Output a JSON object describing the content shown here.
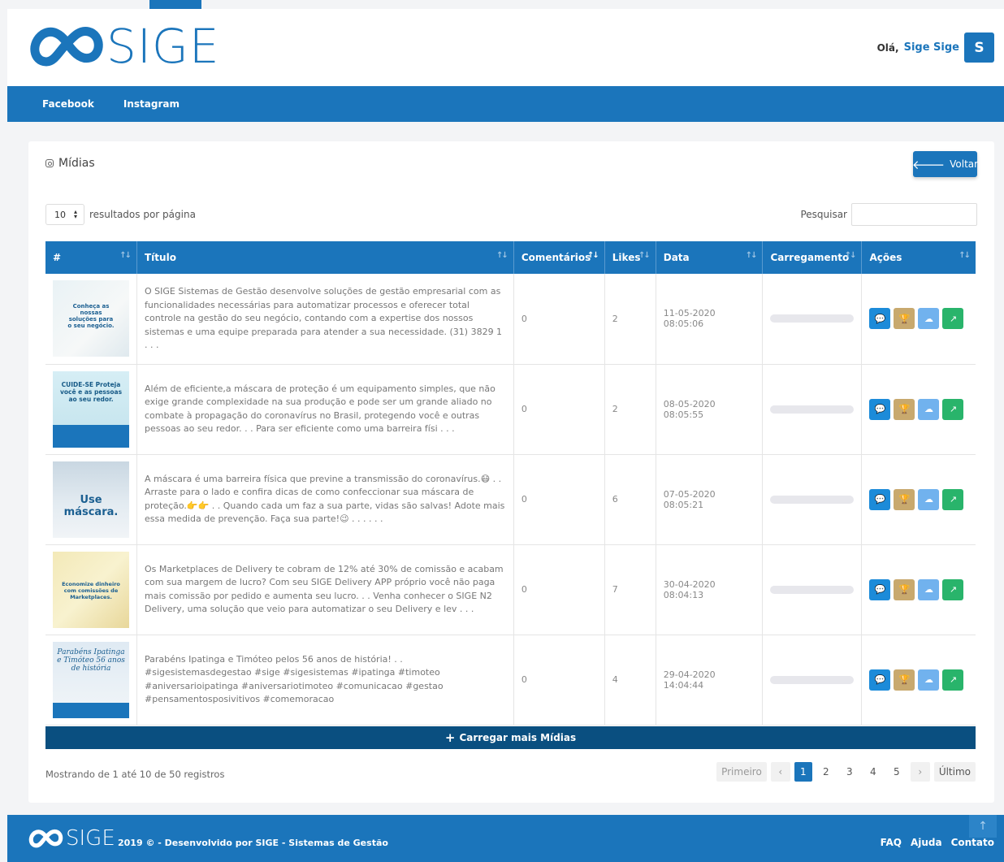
{
  "brand": {
    "name": "SIGE",
    "color": "#1b75bb"
  },
  "header": {
    "greeting": "Olá,",
    "user_name": "Sige Sige",
    "avatar_initial": "S"
  },
  "nav": {
    "items": [
      {
        "label": "Facebook"
      },
      {
        "label": "Instagram"
      }
    ]
  },
  "card": {
    "title": "Mídias",
    "back_label": "Voltar"
  },
  "controls": {
    "page_length": "10",
    "page_length_suffix": "resultados por página",
    "search_label": "Pesquisar",
    "search_value": ""
  },
  "table": {
    "columns": [
      {
        "label": "#"
      },
      {
        "label": "Título"
      },
      {
        "label": "Comentários"
      },
      {
        "label": "Likes"
      },
      {
        "label": "Data"
      },
      {
        "label": "Carregamento"
      },
      {
        "label": "Ações"
      }
    ],
    "rows": [
      {
        "thumb_text": "Conheça as nossas soluções para o seu negócio.",
        "title": "O SIGE Sistemas de Gestão desenvolve soluções de gestão empresarial com as funcionalidades necessárias para automatizar processos e oferecer total controle na gestão do seu negócio, contando com a expertise dos nossos sistemas e uma equipe preparada para atender a sua necessidade. (31) 3829 1 . . .",
        "comments": "0",
        "likes": "2",
        "date": "11-05-2020 08:05:06"
      },
      {
        "thumb_text": "CUIDE-SE Proteja você e as pessoas ao seu redor.",
        "title": "Além de eficiente,a máscara de proteção é um equipamento simples, que não exige grande complexidade na sua produção e pode ser um grande aliado no combate à propagação do coronavírus no Brasil, protegendo você e outras pessoas ao seu redor. . . Para ser eficiente como uma barreira físi . . .",
        "comments": "0",
        "likes": "2",
        "date": "08-05-2020 08:05:55"
      },
      {
        "thumb_text": "Use máscara.",
        "title": "A máscara é uma barreira física que previne a transmissão do coronavírus.😷 . . Arraste para o lado e confira dicas de como confeccionar sua máscara de proteção.👉👉 . . Quando cada um faz a sua parte, vidas são salvas! Adote mais essa medida de prevenção. Faça sua parte!😉 . . . . . .",
        "comments": "0",
        "likes": "6",
        "date": "07-05-2020 08:05:21"
      },
      {
        "thumb_text": "Economize dinheiro com comissões de Marketplaces.",
        "title": "Os Marketplaces de Delivery te cobram de 12% até 30% de comissão e acabam com sua margem de lucro? Com seu SIGE Delivery APP próprio você não paga mais comissão por pedido e aumenta seu lucro. . . Venha conhecer o SIGE N2 Delivery, uma solução que veio para automatizar o seu Delivery e lev . . .",
        "comments": "0",
        "likes": "7",
        "date": "30-04-2020 08:04:13"
      },
      {
        "thumb_text": "Parabéns Ipatinga e Timóteo 56 anos de história",
        "title": "Parabéns Ipatinga e Timóteo pelos 56 anos de história! . . #sigesistemasdegestao #sige #sigesistemas #ipatinga #timoteo #aniversarioipatinga #aniversariotimoteo #comunicacao #gestao #pensamentosposivitivos #comemoracao",
        "comments": "0",
        "likes": "4",
        "date": "29-04-2020 14:04:44"
      }
    ],
    "load_more": "Carregar mais Mídias"
  },
  "footer_info": "Mostrando de 1 até 10 de 50 registros",
  "pagination": {
    "first": "Primeiro",
    "prev": "‹",
    "pages": [
      "1",
      "2",
      "3",
      "4",
      "5"
    ],
    "next": "›",
    "last": "Último",
    "current": "1"
  },
  "footer": {
    "copyright": "2019 © - Desenvolvido por SIGE - Sistemas de Gestão",
    "links": [
      {
        "label": "FAQ"
      },
      {
        "label": "Ajuda"
      },
      {
        "label": "Contato"
      }
    ]
  },
  "icons": {
    "comment": "comment-icon",
    "trophy": "trophy-icon",
    "cloud": "cloud-download-icon",
    "link": "external-link-icon",
    "back": "arrow-left-icon",
    "plus": "plus-icon"
  }
}
